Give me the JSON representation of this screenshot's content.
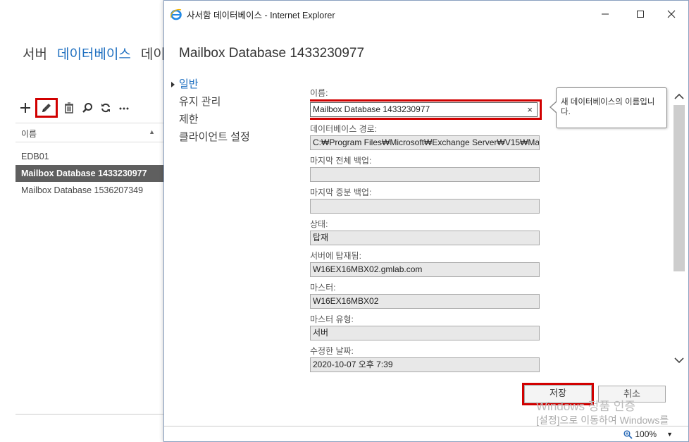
{
  "background": {
    "tabs": [
      {
        "label": "서버",
        "active": false
      },
      {
        "label": "데이터베이스",
        "active": true
      },
      {
        "label": "데이",
        "active": false
      }
    ],
    "list_header": "이름",
    "rows": [
      {
        "label": "EDB01",
        "selected": false
      },
      {
        "label": "Mailbox Database 1433230977",
        "selected": true
      },
      {
        "label": "Mailbox Database 1536207349",
        "selected": false
      }
    ]
  },
  "window": {
    "title": "사서함 데이터베이스 - Internet Explorer",
    "dialog_title": "Mailbox Database 1433230977",
    "nav": [
      {
        "label": "일반",
        "active": true
      },
      {
        "label": "유지 관리",
        "active": false
      },
      {
        "label": "제한",
        "active": false
      },
      {
        "label": "클라이언트 설정",
        "active": false
      }
    ],
    "fields": {
      "name": {
        "label": "이름:",
        "value": "Mailbox Database 1433230977"
      },
      "db_path": {
        "label": "데이터베이스 경로:",
        "value": "C:₩Program Files₩Microsoft₩Exchange Server₩V15₩Mailb"
      },
      "last_full_backup": {
        "label": "마지막 전체 백업:",
        "value": ""
      },
      "last_incremental_backup": {
        "label": "마지막 증분 백업:",
        "value": ""
      },
      "status": {
        "label": "상태:",
        "value": "탑재"
      },
      "mounted_on": {
        "label": "서버에 탑재됨:",
        "value": "W16EX16MBX02.gmlab.com"
      },
      "master": {
        "label": "마스터:",
        "value": "W16EX16MBX02"
      },
      "master_type": {
        "label": "마스터 유형:",
        "value": "서버"
      },
      "modified": {
        "label": "수정한 날짜:",
        "value": "2020-10-07 오후 7:39"
      }
    },
    "tooltip": "새 데이터베이스의 이름입니다.",
    "buttons": {
      "save": "저장",
      "cancel": "취소"
    },
    "watermark": {
      "line1": "Windows 정품 인증",
      "line2": "[설정]으로 이동하여 Windows를"
    },
    "zoom": "100%"
  },
  "colors": {
    "accent": "#1e6fc0",
    "highlight_red": "#d10000",
    "selected_row": "#5f5f5f"
  }
}
